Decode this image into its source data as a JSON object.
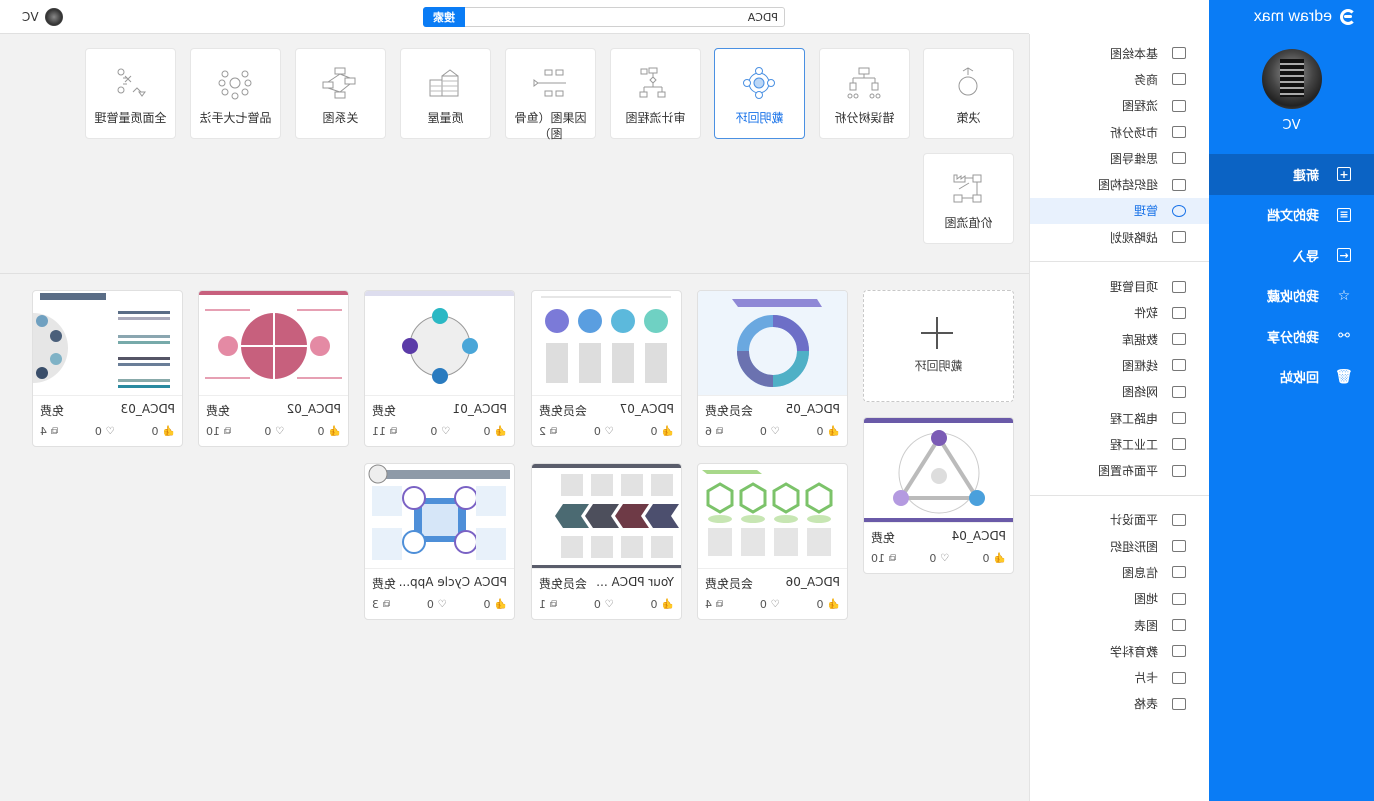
{
  "app": {
    "brand": "edraw max",
    "user": "VC"
  },
  "sidebar": {
    "items": [
      {
        "label": "新建",
        "icon": "new-file-icon",
        "glyph": "+",
        "active": true
      },
      {
        "label": "我的文档",
        "icon": "documents-icon",
        "glyph": "≡"
      },
      {
        "label": "导入",
        "icon": "import-icon",
        "glyph": "←"
      },
      {
        "label": "我的收藏",
        "icon": "star-icon",
        "glyph": "☆"
      },
      {
        "label": "我的分享",
        "icon": "share-icon",
        "glyph": "⚯"
      },
      {
        "label": "回收站",
        "icon": "trash-icon",
        "glyph": "🗑"
      }
    ]
  },
  "categories": {
    "group1": [
      {
        "label": "基本绘图",
        "icon": "basic-shapes-icon"
      },
      {
        "label": "商务",
        "icon": "briefcase-icon"
      },
      {
        "label": "流程图",
        "icon": "flowchart-icon"
      },
      {
        "label": "市场分析",
        "icon": "market-analysis-icon"
      },
      {
        "label": "思维导图",
        "icon": "mindmap-icon"
      },
      {
        "label": "组织结构图",
        "icon": "org-chart-icon"
      },
      {
        "label": "管理",
        "icon": "management-icon",
        "active": true
      },
      {
        "label": "战略规划",
        "icon": "strategy-icon"
      }
    ],
    "group2": [
      {
        "label": "项目管理",
        "icon": "project-icon"
      },
      {
        "label": "软件",
        "icon": "software-icon"
      },
      {
        "label": "数据库",
        "icon": "database-icon"
      },
      {
        "label": "线框图",
        "icon": "wireframe-icon"
      },
      {
        "label": "网络图",
        "icon": "network-icon"
      },
      {
        "label": "电路工程",
        "icon": "circuit-icon"
      },
      {
        "label": "工业工程",
        "icon": "industrial-icon"
      },
      {
        "label": "平面布置图",
        "icon": "floorplan-icon"
      }
    ],
    "group3": [
      {
        "label": "平面设计",
        "icon": "graphic-design-icon"
      },
      {
        "label": "图形组织",
        "icon": "graphic-organizer-icon"
      },
      {
        "label": "信息图",
        "icon": "infographic-icon"
      },
      {
        "label": "地图",
        "icon": "map-icon"
      },
      {
        "label": "图表",
        "icon": "chart-icon"
      },
      {
        "label": "教育科学",
        "icon": "science-icon"
      },
      {
        "label": "卡片",
        "icon": "card-icon"
      },
      {
        "label": "表格",
        "icon": "table-icon"
      }
    ]
  },
  "search": {
    "value": "PDCA",
    "button": "搜索"
  },
  "diagram_types": [
    {
      "label": "决策",
      "icon": "decision-icon"
    },
    {
      "label": "错误树分析",
      "icon": "fault-tree-icon"
    },
    {
      "label": "戴明回环",
      "icon": "deming-cycle-icon",
      "active": true
    },
    {
      "label": "审计流程图",
      "icon": "audit-flowchart-icon"
    },
    {
      "label": "因果图（鱼骨图）",
      "icon": "fishbone-icon"
    },
    {
      "label": "质量屋",
      "icon": "house-of-quality-icon"
    },
    {
      "label": "关系图",
      "icon": "relationship-icon"
    },
    {
      "label": "品管七大手法",
      "icon": "seven-qc-tools-icon"
    },
    {
      "label": "全面质量管理",
      "icon": "tqm-icon"
    },
    {
      "label": "价值流图",
      "icon": "value-stream-icon"
    }
  ],
  "new_blank": {
    "label": "戴明回环"
  },
  "templates": [
    {
      "name": "PDCA_04",
      "price": "免费",
      "likes": "0",
      "favorites": "0",
      "copies": "10"
    },
    {
      "name": "PDCA_05",
      "price": "会员免费",
      "likes": "0",
      "favorites": "0",
      "copies": "6"
    },
    {
      "name": "PDCA_07",
      "price": "会员免费",
      "likes": "0",
      "favorites": "0",
      "copies": "2"
    },
    {
      "name": "PDCA_01",
      "price": "免费",
      "likes": "0",
      "favorites": "0",
      "copies": "11"
    },
    {
      "name": "PDCA_02",
      "price": "免费",
      "likes": "0",
      "favorites": "0",
      "copies": "10"
    },
    {
      "name": "PDCA_03",
      "price": "免费",
      "likes": "0",
      "favorites": "0",
      "copies": "4"
    },
    {
      "name": "PDCA_06",
      "price": "会员免费",
      "likes": "0",
      "favorites": "0",
      "copies": "4"
    },
    {
      "name": "Your PDCA ...",
      "price": "会员免费",
      "likes": "0",
      "favorites": "0",
      "copies": "1"
    },
    {
      "name": "PDCA Cycle App...",
      "price": "免费",
      "likes": "0",
      "favorites": "0",
      "copies": "3"
    }
  ]
}
